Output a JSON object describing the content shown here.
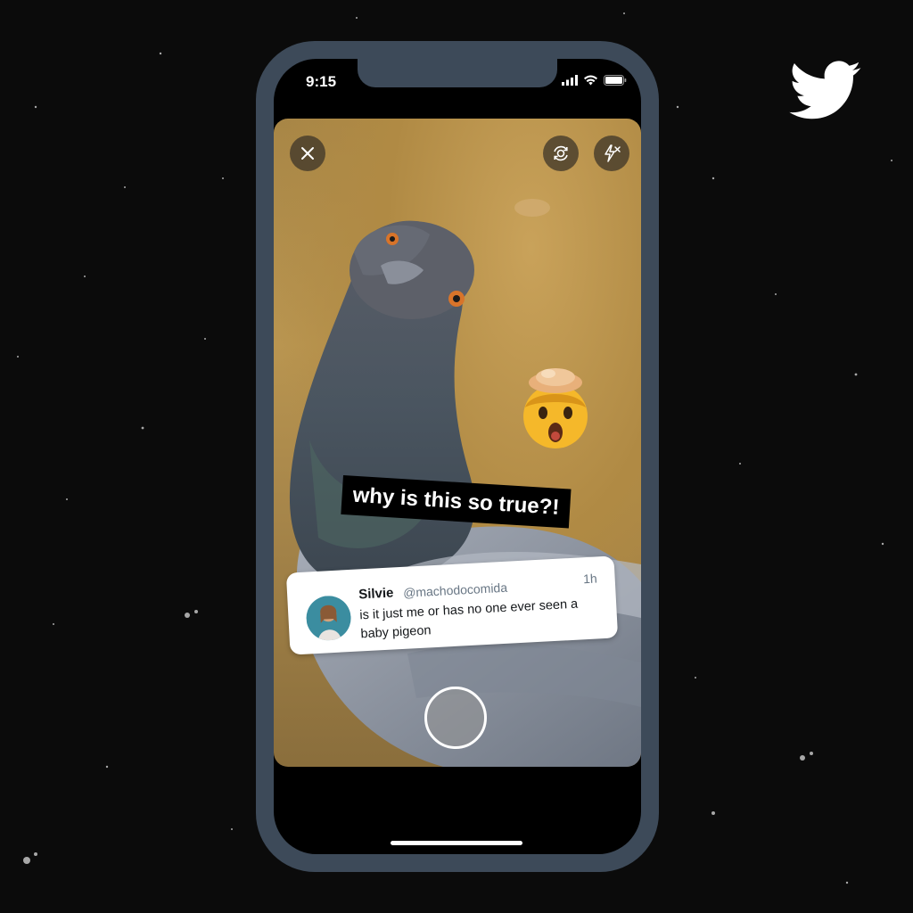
{
  "status_bar": {
    "time": "9:15"
  },
  "camera_controls": {
    "close_icon": "close-icon",
    "flip_icon": "flip-camera-icon",
    "flash_icon": "flash-off-icon"
  },
  "story": {
    "caption": "why is this so true?!",
    "sticker": "exploding-head-emoji"
  },
  "tweet": {
    "name": "Silvie",
    "handle": "@machodocomida",
    "time": "1h",
    "text": "is it just me or has no one ever seen a baby pigeon"
  },
  "brand": {
    "logo": "twitter-bird-logo",
    "logo_color": "#ffffff"
  }
}
